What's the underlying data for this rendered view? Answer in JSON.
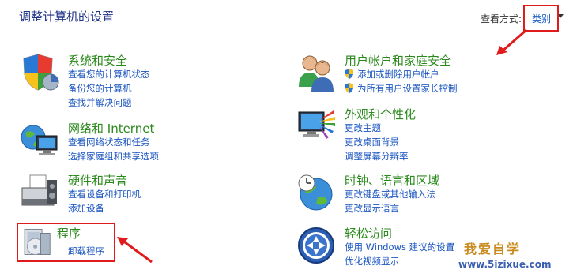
{
  "header": {
    "title": "调整计算机的设置",
    "view_by_label": "查看方式:",
    "view_by_value": "类别"
  },
  "categories": [
    {
      "title": "系统和安全",
      "links": [
        "查看您的计算机状态",
        "备份您的计算机",
        "查找并解决问题"
      ]
    },
    {
      "title": "网络和 Internet",
      "links": [
        "查看网络状态和任务",
        "选择家庭组和共享选项"
      ]
    },
    {
      "title": "硬件和声音",
      "links": [
        "查看设备和打印机",
        "添加设备"
      ]
    },
    {
      "title": "程序",
      "links": [
        "卸载程序"
      ]
    },
    {
      "title": "用户帐户和家庭安全",
      "links": [
        "添加或删除用户帐户",
        "为所有用户设置家长控制"
      ]
    },
    {
      "title": "外观和个性化",
      "links": [
        "更改主题",
        "更改桌面背景",
        "调整屏幕分辨率"
      ]
    },
    {
      "title": "时钟、语言和区域",
      "links": [
        "更改键盘或其他输入法",
        "更改显示语言"
      ]
    },
    {
      "title": "轻松访问",
      "links": [
        "使用 Windows 建议的设置",
        "优化视频显示"
      ]
    }
  ],
  "watermark": {
    "line1": "我爱自学",
    "line2": "www.5izixue.com"
  },
  "colors": {
    "heading": "#2b8a1c",
    "link": "#1a55c0",
    "title": "#1e3287",
    "highlight": "#e11b1b"
  }
}
